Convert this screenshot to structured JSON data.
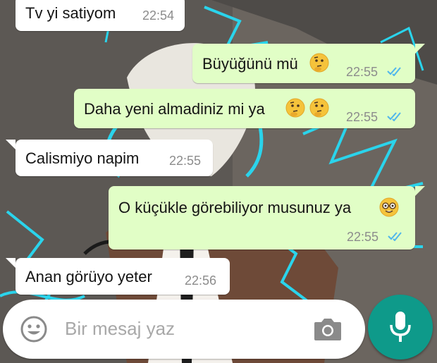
{
  "colors": {
    "accent": "#0e9a8a",
    "outgoing_bubble": "#e1fec6",
    "incoming_bubble": "#ffffff",
    "read_ticks": "#4fb6ec",
    "time_text": "#8c8c8c"
  },
  "messages": [
    {
      "direction": "incoming",
      "text": "Tv yi satiyom",
      "time": "22:54"
    },
    {
      "direction": "outgoing",
      "text": "Büyüğünü mü",
      "time": "22:55",
      "emoji": [
        "thinking-face"
      ],
      "status": "read"
    },
    {
      "direction": "outgoing",
      "text": "Daha yeni almadiniz mi ya",
      "time": "22:55",
      "emoji": [
        "thinking-face",
        "thinking-face"
      ],
      "status": "read"
    },
    {
      "direction": "incoming",
      "text": "Calismiyo napim",
      "time": "22:55"
    },
    {
      "direction": "outgoing",
      "text": "O küçükle görebiliyor musunuz ya",
      "time": "22:55",
      "emoji": [
        "nerd-face"
      ],
      "status": "read"
    },
    {
      "direction": "incoming",
      "text": "Anan görüyo  yeter",
      "time": "22:56"
    }
  ],
  "composer": {
    "placeholder": "Bir mesaj yaz",
    "icons": [
      "emoji-icon",
      "camera-icon",
      "microphone-icon"
    ]
  }
}
